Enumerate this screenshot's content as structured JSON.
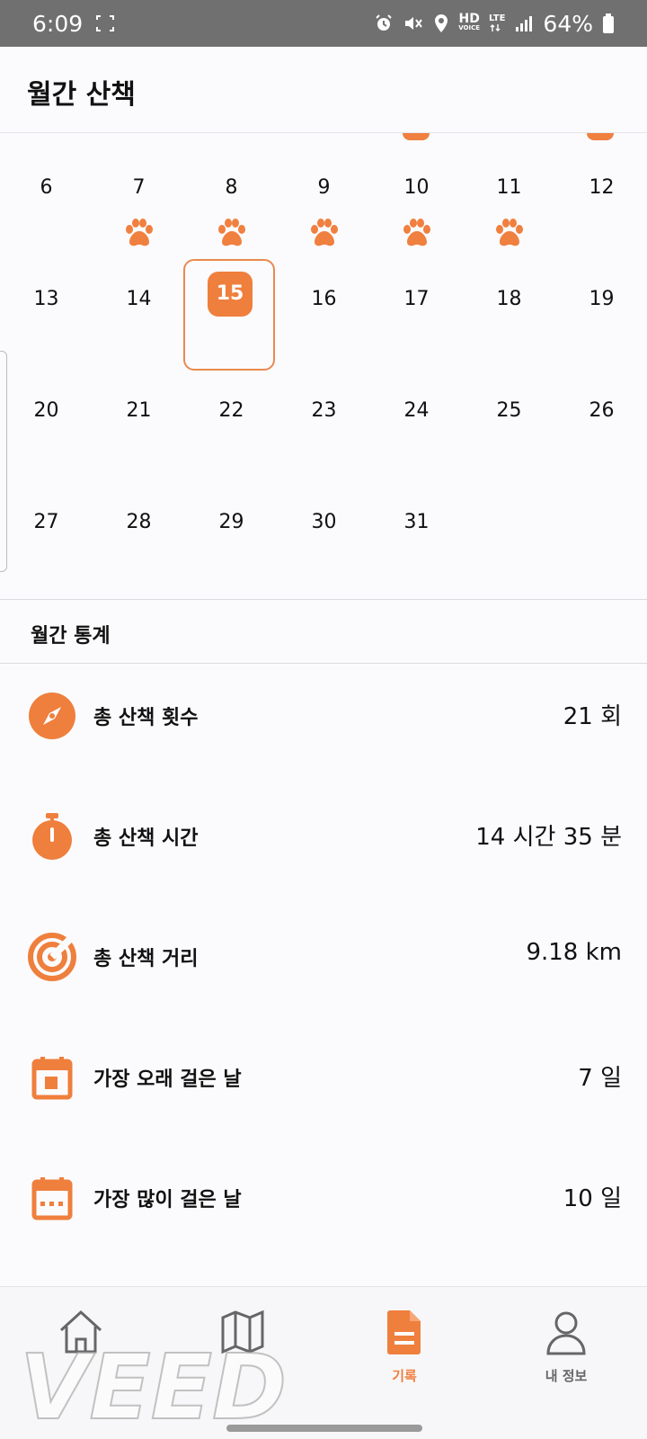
{
  "status_bar": {
    "time": "6:09",
    "battery": "64%",
    "hd_label": "HD",
    "voice_label": "VOICE",
    "lte_label": "LTE"
  },
  "header": {
    "title": "월간 산책"
  },
  "calendar": {
    "weeks": [
      [
        "6",
        "7",
        "8",
        "9",
        "10",
        "11",
        "12"
      ],
      [
        "13",
        "14",
        "15",
        "16",
        "17",
        "18",
        "19"
      ],
      [
        "20",
        "21",
        "22",
        "23",
        "24",
        "25",
        "26"
      ],
      [
        "27",
        "28",
        "29",
        "30",
        "31",
        "",
        ""
      ]
    ],
    "walked_days": [
      "7",
      "8",
      "9",
      "10",
      "11"
    ],
    "selected_day": "15"
  },
  "stats": {
    "title": "월간 통계",
    "rows": [
      {
        "label": "총 산책 횟수",
        "value": "21 회",
        "icon": "compass-icon"
      },
      {
        "label": "총 산책 시간",
        "value": "14 시간 35 분",
        "icon": "stopwatch-icon"
      },
      {
        "label": "총 산책 거리",
        "value": "9.18 km",
        "icon": "distance-icon"
      },
      {
        "label": "가장 오래 걸은 날",
        "value": "7 일",
        "icon": "calendar-day-icon"
      },
      {
        "label": "가장 많이 걸은 날",
        "value": "10 일",
        "icon": "calendar-dots-icon"
      }
    ]
  },
  "nav": {
    "items": [
      {
        "label": "",
        "icon": "home-icon"
      },
      {
        "label": "",
        "icon": "map-icon"
      },
      {
        "label": "기록",
        "icon": "document-icon",
        "active": true
      },
      {
        "label": "내 정보",
        "icon": "user-icon"
      }
    ]
  },
  "watermark": "VEED",
  "colors": {
    "accent": "#ef7f3d",
    "statusbar": "#707070"
  }
}
